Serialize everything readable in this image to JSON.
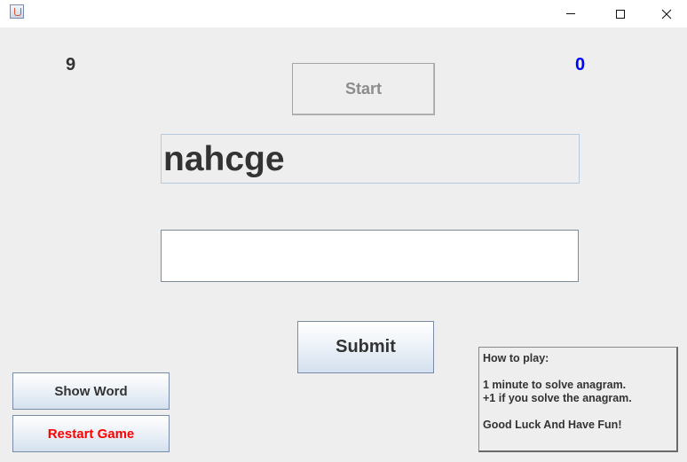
{
  "window": {
    "app_icon": "java-cup-icon",
    "controls": {
      "minimize": "minimize-icon",
      "maximize": "maximize-icon",
      "close": "close-icon"
    }
  },
  "game": {
    "timer_value": "9",
    "score_value": "0",
    "start_label": "Start",
    "anagram": "nahcge",
    "answer_value": "",
    "submit_label": "Submit",
    "show_word_label": "Show Word",
    "restart_label": "Restart Game"
  },
  "instructions": {
    "title": "How to play:",
    "line1": "1 minute to solve anagram.",
    "line2": "+1 if you solve the anagram.",
    "line3": "Good Luck And Have Fun!"
  },
  "colors": {
    "score": "#0000ff",
    "restart": "#ff0000",
    "background": "#eeeeee"
  }
}
